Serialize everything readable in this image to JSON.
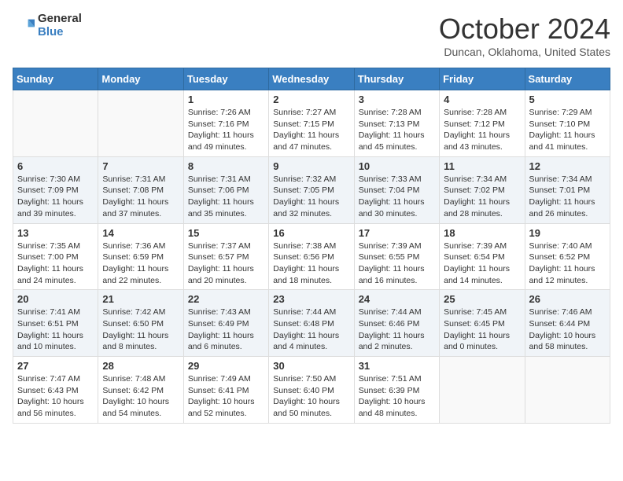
{
  "header": {
    "logo_general": "General",
    "logo_blue": "Blue",
    "title": "October 2024",
    "location": "Duncan, Oklahoma, United States"
  },
  "calendar": {
    "days_of_week": [
      "Sunday",
      "Monday",
      "Tuesday",
      "Wednesday",
      "Thursday",
      "Friday",
      "Saturday"
    ],
    "weeks": [
      [
        {
          "day": "",
          "info": ""
        },
        {
          "day": "",
          "info": ""
        },
        {
          "day": "1",
          "info": "Sunrise: 7:26 AM\nSunset: 7:16 PM\nDaylight: 11 hours and 49 minutes."
        },
        {
          "day": "2",
          "info": "Sunrise: 7:27 AM\nSunset: 7:15 PM\nDaylight: 11 hours and 47 minutes."
        },
        {
          "day": "3",
          "info": "Sunrise: 7:28 AM\nSunset: 7:13 PM\nDaylight: 11 hours and 45 minutes."
        },
        {
          "day": "4",
          "info": "Sunrise: 7:28 AM\nSunset: 7:12 PM\nDaylight: 11 hours and 43 minutes."
        },
        {
          "day": "5",
          "info": "Sunrise: 7:29 AM\nSunset: 7:10 PM\nDaylight: 11 hours and 41 minutes."
        }
      ],
      [
        {
          "day": "6",
          "info": "Sunrise: 7:30 AM\nSunset: 7:09 PM\nDaylight: 11 hours and 39 minutes."
        },
        {
          "day": "7",
          "info": "Sunrise: 7:31 AM\nSunset: 7:08 PM\nDaylight: 11 hours and 37 minutes."
        },
        {
          "day": "8",
          "info": "Sunrise: 7:31 AM\nSunset: 7:06 PM\nDaylight: 11 hours and 35 minutes."
        },
        {
          "day": "9",
          "info": "Sunrise: 7:32 AM\nSunset: 7:05 PM\nDaylight: 11 hours and 32 minutes."
        },
        {
          "day": "10",
          "info": "Sunrise: 7:33 AM\nSunset: 7:04 PM\nDaylight: 11 hours and 30 minutes."
        },
        {
          "day": "11",
          "info": "Sunrise: 7:34 AM\nSunset: 7:02 PM\nDaylight: 11 hours and 28 minutes."
        },
        {
          "day": "12",
          "info": "Sunrise: 7:34 AM\nSunset: 7:01 PM\nDaylight: 11 hours and 26 minutes."
        }
      ],
      [
        {
          "day": "13",
          "info": "Sunrise: 7:35 AM\nSunset: 7:00 PM\nDaylight: 11 hours and 24 minutes."
        },
        {
          "day": "14",
          "info": "Sunrise: 7:36 AM\nSunset: 6:59 PM\nDaylight: 11 hours and 22 minutes."
        },
        {
          "day": "15",
          "info": "Sunrise: 7:37 AM\nSunset: 6:57 PM\nDaylight: 11 hours and 20 minutes."
        },
        {
          "day": "16",
          "info": "Sunrise: 7:38 AM\nSunset: 6:56 PM\nDaylight: 11 hours and 18 minutes."
        },
        {
          "day": "17",
          "info": "Sunrise: 7:39 AM\nSunset: 6:55 PM\nDaylight: 11 hours and 16 minutes."
        },
        {
          "day": "18",
          "info": "Sunrise: 7:39 AM\nSunset: 6:54 PM\nDaylight: 11 hours and 14 minutes."
        },
        {
          "day": "19",
          "info": "Sunrise: 7:40 AM\nSunset: 6:52 PM\nDaylight: 11 hours and 12 minutes."
        }
      ],
      [
        {
          "day": "20",
          "info": "Sunrise: 7:41 AM\nSunset: 6:51 PM\nDaylight: 11 hours and 10 minutes."
        },
        {
          "day": "21",
          "info": "Sunrise: 7:42 AM\nSunset: 6:50 PM\nDaylight: 11 hours and 8 minutes."
        },
        {
          "day": "22",
          "info": "Sunrise: 7:43 AM\nSunset: 6:49 PM\nDaylight: 11 hours and 6 minutes."
        },
        {
          "day": "23",
          "info": "Sunrise: 7:44 AM\nSunset: 6:48 PM\nDaylight: 11 hours and 4 minutes."
        },
        {
          "day": "24",
          "info": "Sunrise: 7:44 AM\nSunset: 6:46 PM\nDaylight: 11 hours and 2 minutes."
        },
        {
          "day": "25",
          "info": "Sunrise: 7:45 AM\nSunset: 6:45 PM\nDaylight: 11 hours and 0 minutes."
        },
        {
          "day": "26",
          "info": "Sunrise: 7:46 AM\nSunset: 6:44 PM\nDaylight: 10 hours and 58 minutes."
        }
      ],
      [
        {
          "day": "27",
          "info": "Sunrise: 7:47 AM\nSunset: 6:43 PM\nDaylight: 10 hours and 56 minutes."
        },
        {
          "day": "28",
          "info": "Sunrise: 7:48 AM\nSunset: 6:42 PM\nDaylight: 10 hours and 54 minutes."
        },
        {
          "day": "29",
          "info": "Sunrise: 7:49 AM\nSunset: 6:41 PM\nDaylight: 10 hours and 52 minutes."
        },
        {
          "day": "30",
          "info": "Sunrise: 7:50 AM\nSunset: 6:40 PM\nDaylight: 10 hours and 50 minutes."
        },
        {
          "day": "31",
          "info": "Sunrise: 7:51 AM\nSunset: 6:39 PM\nDaylight: 10 hours and 48 minutes."
        },
        {
          "day": "",
          "info": ""
        },
        {
          "day": "",
          "info": ""
        }
      ]
    ]
  }
}
